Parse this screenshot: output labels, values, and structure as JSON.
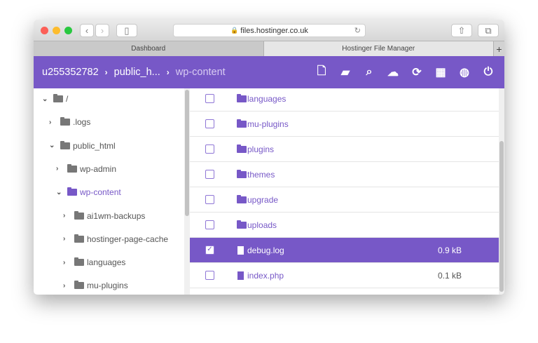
{
  "browser": {
    "url": "files.hostinger.co.uk",
    "tabs": [
      "Dashboard",
      "Hostinger File Manager"
    ],
    "new_tab": "+"
  },
  "header": {
    "breadcrumb": [
      "u255352782",
      "public_h...",
      "wp-content"
    ],
    "icons": [
      "new-file-icon",
      "new-folder-icon",
      "search-icon",
      "upload-icon",
      "refresh-icon",
      "grid-view-icon",
      "globe-icon",
      "power-icon"
    ]
  },
  "tree": [
    {
      "label": "/",
      "level": 0,
      "open": true
    },
    {
      "label": ".logs",
      "level": 1,
      "open": false
    },
    {
      "label": "public_html",
      "level": 1,
      "open": true
    },
    {
      "label": "wp-admin",
      "level": 2,
      "open": false
    },
    {
      "label": "wp-content",
      "level": 2,
      "open": true,
      "active": true
    },
    {
      "label": "ai1wm-backups",
      "level": 3,
      "open": false
    },
    {
      "label": "hostinger-page-cache",
      "level": 3,
      "open": false
    },
    {
      "label": "languages",
      "level": 3,
      "open": false
    },
    {
      "label": "mu-plugins",
      "level": 3,
      "open": false
    }
  ],
  "files": [
    {
      "name": "languages",
      "type": "folder",
      "size": "",
      "checked": false
    },
    {
      "name": "mu-plugins",
      "type": "folder",
      "size": "",
      "checked": false
    },
    {
      "name": "plugins",
      "type": "folder",
      "size": "",
      "checked": false
    },
    {
      "name": "themes",
      "type": "folder",
      "size": "",
      "checked": false
    },
    {
      "name": "upgrade",
      "type": "folder",
      "size": "",
      "checked": false
    },
    {
      "name": "uploads",
      "type": "folder",
      "size": "",
      "checked": false
    },
    {
      "name": "debug.log",
      "type": "file",
      "size": "0.9 kB",
      "checked": true
    },
    {
      "name": "index.php",
      "type": "file",
      "size": "0.1 kB",
      "checked": false
    }
  ],
  "colors": {
    "accent": "#7758c7"
  }
}
